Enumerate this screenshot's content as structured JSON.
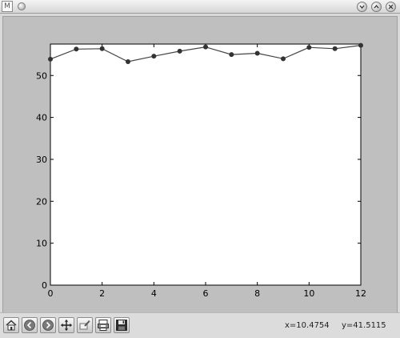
{
  "window": {
    "logo_text": "M",
    "controls": [
      "minimize",
      "maximize",
      "close"
    ]
  },
  "toolbar": {
    "buttons": [
      "home",
      "back",
      "forward",
      "pan",
      "zoom",
      "subplots",
      "save"
    ],
    "cursor_x": "x=10.4754",
    "cursor_y": "y=41.5115"
  },
  "chart_data": {
    "type": "line",
    "x": [
      0,
      1,
      2,
      3,
      4,
      5,
      6,
      7,
      8,
      9,
      10,
      11,
      12
    ],
    "y": [
      53.9,
      56.3,
      56.4,
      53.3,
      54.6,
      55.8,
      56.8,
      55.0,
      55.3,
      54.0,
      56.7,
      56.4,
      57.2
    ],
    "xlim": [
      0,
      12
    ],
    "ylim": [
      0,
      57.5
    ],
    "xticks": [
      "0",
      "2",
      "4",
      "6",
      "8",
      "10",
      "12"
    ],
    "yticks": [
      "0",
      "10",
      "20",
      "30",
      "40",
      "50"
    ],
    "title": "",
    "xlabel": "",
    "ylabel": "",
    "grid": false,
    "line_color": "#444444",
    "marker_color": "#333333"
  }
}
